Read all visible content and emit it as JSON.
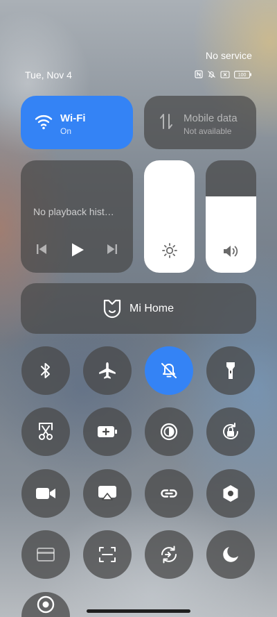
{
  "status": {
    "carrier": "No service",
    "date": "Tue, Nov 4",
    "icons": [
      "nfc-icon",
      "notifications-off-icon",
      "no-sim-icon",
      "battery-icon"
    ],
    "battery_level": "100"
  },
  "wifi": {
    "title": "Wi-Fi",
    "status": "On",
    "active": true
  },
  "mobile_data": {
    "title": "Mobile data",
    "status": "Not available",
    "active": false
  },
  "media": {
    "text": "No playback hist…",
    "controls": [
      "previous-icon",
      "play-icon",
      "next-icon"
    ]
  },
  "brightness": {
    "level": 1.0,
    "icon": "brightness-icon"
  },
  "volume": {
    "level": 0.68,
    "icon": "volume-icon"
  },
  "mi_home": {
    "label": "Mi Home",
    "icon": "mi-home-icon"
  },
  "toggles": [
    {
      "name": "bluetooth",
      "icon": "bluetooth-icon",
      "active": false
    },
    {
      "name": "airplane-mode",
      "icon": "airplane-icon",
      "active": false
    },
    {
      "name": "silent-mode",
      "icon": "bell-off-icon",
      "active": true
    },
    {
      "name": "flashlight",
      "icon": "flashlight-icon",
      "active": false
    },
    {
      "name": "screenshot",
      "icon": "scissors-icon",
      "active": false
    },
    {
      "name": "battery-saver",
      "icon": "battery-plus-icon",
      "active": false
    },
    {
      "name": "dark-mode",
      "icon": "contrast-icon",
      "active": false
    },
    {
      "name": "rotation-lock",
      "icon": "rotation-lock-icon",
      "active": false
    },
    {
      "name": "screen-recorder",
      "icon": "video-camera-icon",
      "active": false
    },
    {
      "name": "cast",
      "icon": "cast-icon",
      "active": false
    },
    {
      "name": "link",
      "icon": "link-icon",
      "active": false
    },
    {
      "name": "settings",
      "icon": "hexagon-settings-icon",
      "active": false
    },
    {
      "name": "card",
      "icon": "card-icon",
      "active": false
    },
    {
      "name": "scanner",
      "icon": "scan-icon",
      "active": false
    },
    {
      "name": "sync",
      "icon": "sync-icon",
      "active": false
    },
    {
      "name": "night-mode",
      "icon": "moon-icon",
      "active": false
    },
    {
      "name": "location",
      "icon": "location-icon",
      "active": false
    }
  ],
  "colors": {
    "accent": "#3483f5",
    "tile": "#484848"
  }
}
